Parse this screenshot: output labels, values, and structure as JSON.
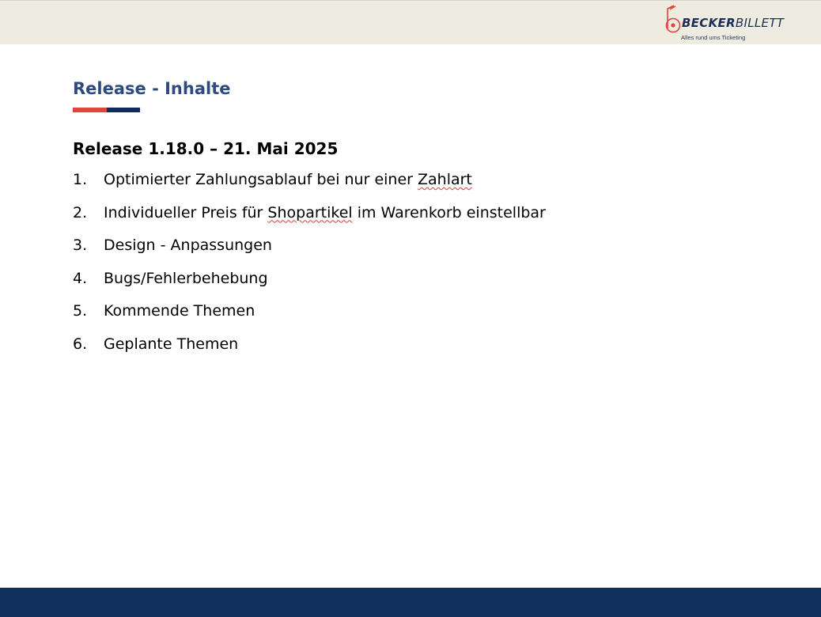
{
  "header": {
    "logo": {
      "word_bold": "BECKER",
      "word_regular": "BILLETT",
      "tagline": "Alles rund ums Ticketing",
      "colors": {
        "mark": "#e1443a",
        "text": "#1d2d55"
      }
    }
  },
  "slide": {
    "title": "Release - Inhalte",
    "release_heading": "Release 1.18.0 – 21. Mai 2025",
    "items": [
      {
        "num": "1.",
        "parts": [
          {
            "text": "Optimierter Zahlungsablauf bei nur einer "
          },
          {
            "text": "Zahlart",
            "spellcheck": true
          }
        ]
      },
      {
        "num": "2.",
        "parts": [
          {
            "text": "Individueller Preis für "
          },
          {
            "text": "Shopartikel",
            "spellcheck": true
          },
          {
            "text": " im Warenkorb einstellbar"
          }
        ]
      },
      {
        "num": "3.",
        "parts": [
          {
            "text": "Design - Anpassungen"
          }
        ]
      },
      {
        "num": "4.",
        "parts": [
          {
            "text": "Bugs/Fehlerbehebung"
          }
        ]
      },
      {
        "num": "5.",
        "parts": [
          {
            "text": "Kommende Themen"
          }
        ]
      },
      {
        "num": "6.",
        "parts": [
          {
            "text": "Geplante Themen"
          }
        ]
      }
    ]
  },
  "theme": {
    "title_color": "#2e4a7e",
    "accent_red": "#e1443a",
    "accent_navy": "#0f2a5e",
    "top_band": "#eeebe1",
    "bottom_band": "#0f2f5c"
  }
}
